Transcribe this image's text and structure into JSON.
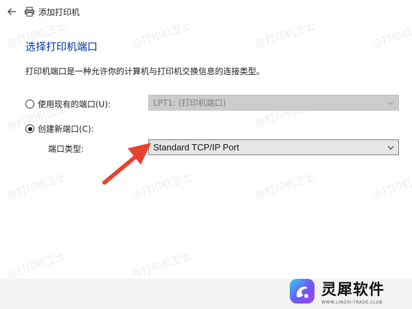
{
  "window": {
    "title": "添加打印机"
  },
  "page": {
    "heading": "选择打印机端口",
    "description": "打印机端口是一种允许你的计算机与打印机交换信息的连接类型。"
  },
  "options": {
    "use_existing_label": "使用现有的端口(U):",
    "use_existing_value": "LPT1: (打印机端口)",
    "create_new_label": "创建新端口(C):",
    "port_type_label": "端口类型:",
    "port_type_value": "Standard TCP/IP Port",
    "selected": "create_new"
  },
  "watermark": {
    "text": "@打印机卫士"
  },
  "branding": {
    "name": "灵犀软件",
    "url": "WWW.LINGXI-TRADE.CLUB"
  },
  "colors": {
    "heading": "#003399",
    "arrow": "#e8412c",
    "disabled_select": "#cccccc",
    "active_select": "#e6e6e6"
  },
  "icons": {
    "back": "back-arrow-icon",
    "printer": "printer-icon",
    "dropdown": "chevron-down-icon",
    "annotation": "red-arrow-icon",
    "logo": "lingxi-logo-icon"
  }
}
